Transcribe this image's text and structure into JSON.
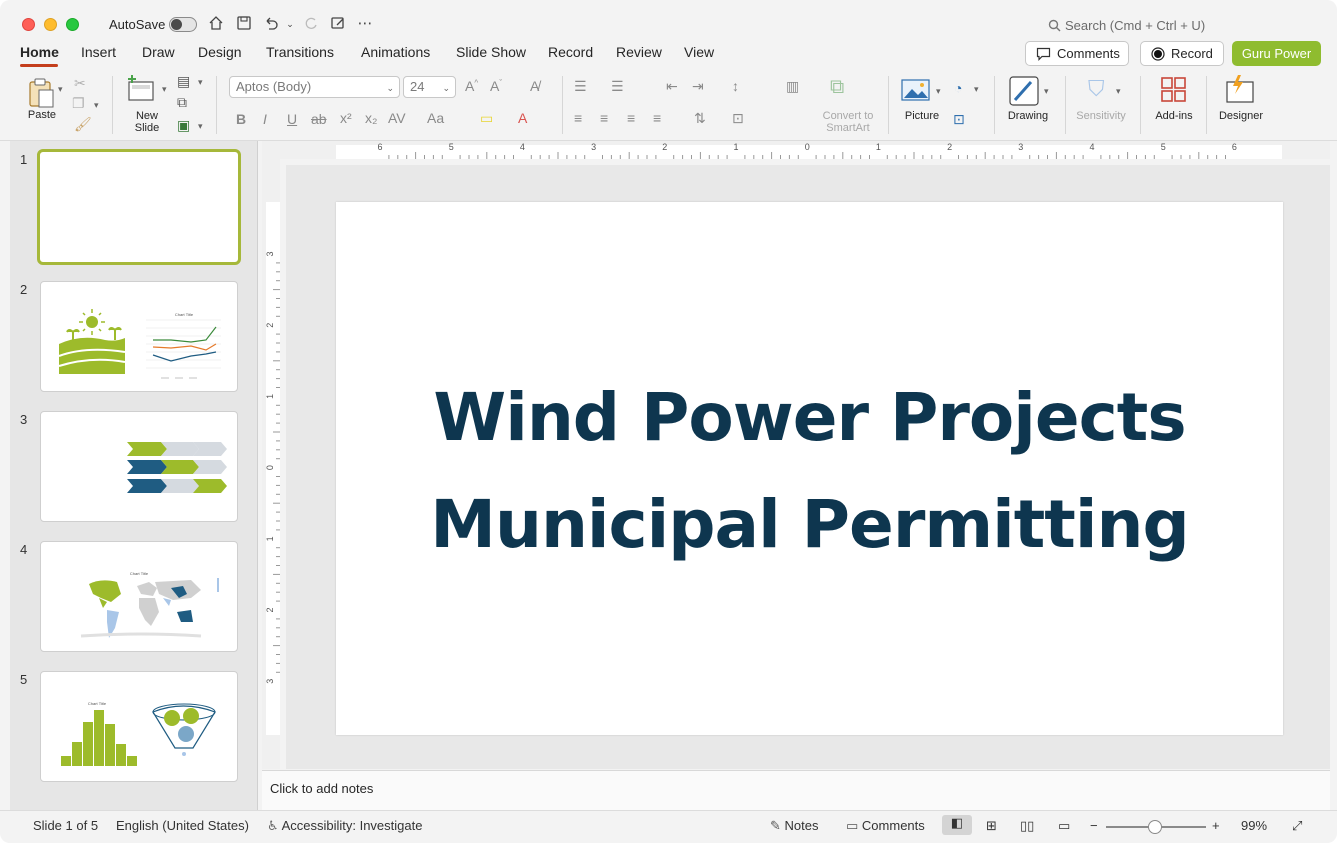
{
  "titlebar": {
    "autosave_label": "AutoSave",
    "search_placeholder": "Search (Cmd + Ctrl + U)"
  },
  "tabs": [
    {
      "label": "Home",
      "active": true
    },
    {
      "label": "Insert"
    },
    {
      "label": "Draw"
    },
    {
      "label": "Design"
    },
    {
      "label": "Transitions"
    },
    {
      "label": "Animations"
    },
    {
      "label": "Slide Show"
    },
    {
      "label": "Record"
    },
    {
      "label": "Review"
    },
    {
      "label": "View"
    }
  ],
  "header_buttons": {
    "comments": "Comments",
    "record": "Record",
    "guru": "Guru Power"
  },
  "ribbon": {
    "paste": "Paste",
    "new_slide_line1": "New",
    "new_slide_line2": "Slide",
    "font_name": "Aptos (Body)",
    "font_size": "24",
    "convert_line1": "Convert to",
    "convert_line2": "SmartArt",
    "picture": "Picture",
    "drawing": "Drawing",
    "sensitivity": "Sensitivity",
    "addins": "Add-ins",
    "designer": "Designer"
  },
  "thumbnails": {
    "numbers": [
      "1",
      "2",
      "3",
      "4",
      "5"
    ],
    "chart_title_2": "Chart Title",
    "chart_title_4": "Chart Title",
    "chart_title_5": "Chart Title"
  },
  "slide": {
    "title_line1": "Wind Power Projects",
    "title_line2": "Municipal Permitting"
  },
  "notes": {
    "placeholder": "Click to add notes"
  },
  "status": {
    "slide_count": "Slide 1 of 5",
    "language": "English (United States)",
    "accessibility": "Accessibility: Investigate",
    "notes": "Notes",
    "comments": "Comments",
    "zoom": "99%"
  },
  "ruler": {
    "h_labels": [
      "6",
      "5",
      "4",
      "3",
      "2",
      "1",
      "0",
      "1",
      "2",
      "3",
      "4",
      "5",
      "6"
    ],
    "v_labels": [
      "3",
      "2",
      "1",
      "0",
      "1",
      "2",
      "3"
    ]
  },
  "colors": {
    "accent_tab": "#c43e1c",
    "guru_green": "#8fbc2f",
    "title_navy": "#0e364f",
    "thumb_green": "#9dbb2b",
    "thumb_blue": "#1f5c82"
  }
}
